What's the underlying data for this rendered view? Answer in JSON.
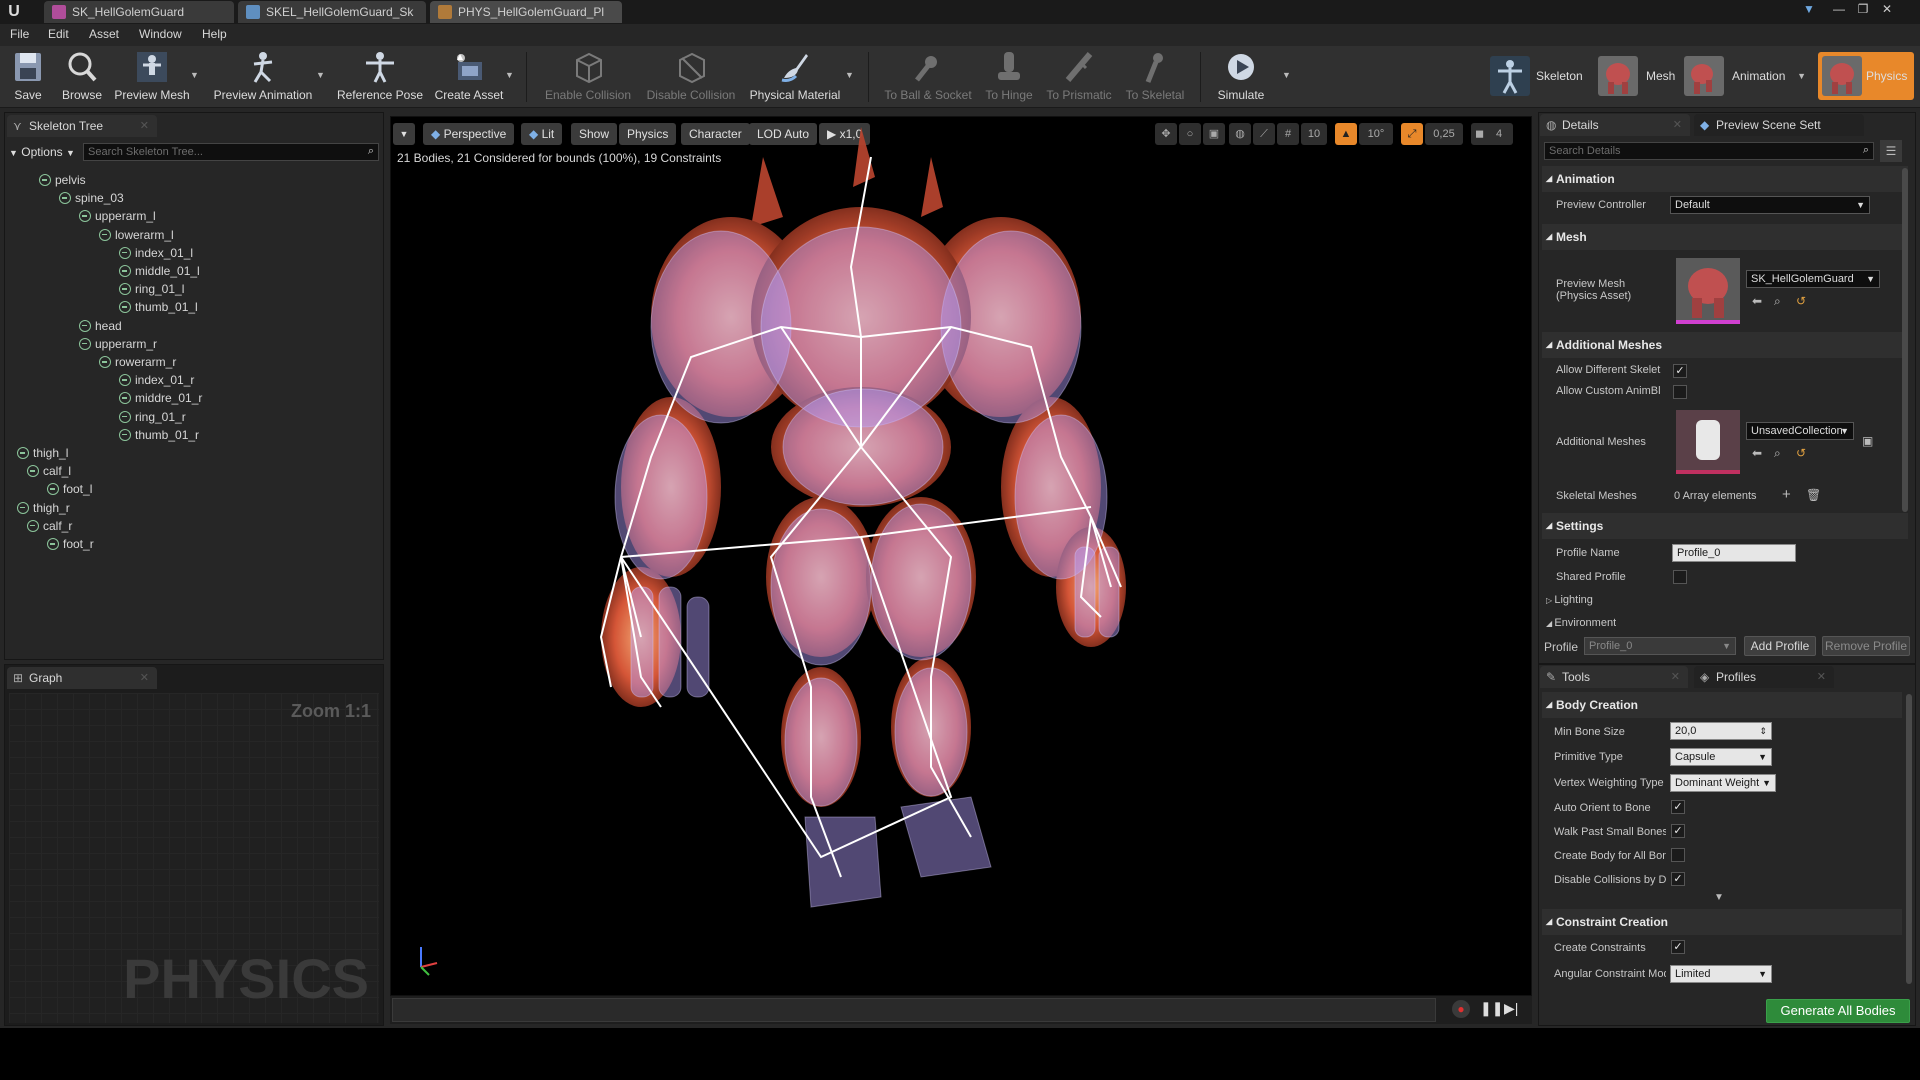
{
  "tabs": [
    {
      "label": "SK_HellGolemGuard",
      "color": "#b04d9a"
    },
    {
      "label": "SKEL_HellGolemGuard_Sk",
      "color": "#5f8fc0"
    },
    {
      "label": "PHYS_HellGolemGuard_Pl",
      "color": "#b07a3a"
    }
  ],
  "window": {
    "minimize": "—",
    "restore": "❐",
    "close": "✕"
  },
  "menu": [
    "File",
    "Edit",
    "Asset",
    "Window",
    "Help"
  ],
  "toolbar": {
    "save": "Save",
    "browse": "Browse",
    "preview_mesh": "Preview Mesh",
    "preview_animation": "Preview Animation",
    "reference_pose": "Reference Pose",
    "create_asset": "Create Asset",
    "enable_collision": "Enable Collision",
    "disable_collision": "Disable Collision",
    "physical_material": "Physical Material",
    "to_ball_socket": "To Ball & Socket",
    "to_hinge": "To Hinge",
    "to_prismatic": "To Prismatic",
    "to_skeletal": "To Skeletal",
    "simulate": "Simulate"
  },
  "modes": {
    "skeleton": "Skeleton",
    "mesh": "Mesh",
    "animation": "Animation",
    "physics": "Physics"
  },
  "skeleton_tree": {
    "tab": "Skeleton Tree",
    "options": "Options",
    "search_placeholder": "Search Skeleton Tree...",
    "bones": [
      "pelvis",
      "spine_03",
      "upperarm_l",
      "lowerarm_l",
      "index_01_l",
      "middle_01_l",
      "ring_01_l",
      "thumb_01_l",
      "head",
      "upperarm_r",
      "rowerarm_r",
      "index_01_r",
      "middre_01_r",
      "ring_01_r",
      "thumb_01_r",
      "thigh_l",
      "calf_l",
      "foot_l",
      "thigh_r",
      "calf_r",
      "foot_r"
    ]
  },
  "graph": {
    "tab": "Graph",
    "zoom": "Zoom 1:1",
    "watermark": "PHYSICS"
  },
  "viewport": {
    "perspective": "Perspective",
    "lit": "Lit",
    "show": "Show",
    "physics": "Physics",
    "character": "Character",
    "lod": "LOD Auto",
    "speed": "x1,0",
    "grid_size": "10",
    "angle": "10°",
    "scale": "0,25",
    "camera_speed": "4",
    "stats": "21 Bodies, 21 Considered for bounds (100%), 19 Constraints"
  },
  "details": {
    "tab": "Details",
    "tab2": "Preview Scene Sett",
    "search_placeholder": "Search Details",
    "animation_section": "Animation",
    "preview_controller_label": "Preview Controller",
    "preview_controller_value": "Default",
    "mesh_section": "Mesh",
    "preview_mesh_label": "Preview Mesh (Physics Asset)",
    "preview_mesh_value": "SK_HellGolemGuard",
    "additional_section": "Additional Meshes",
    "allow_diff_skel": "Allow Different Skelet",
    "allow_custom_anim": "Allow Custom AnimBl",
    "additional_meshes_label": "Additional Meshes",
    "additional_meshes_value": "UnsavedCollection",
    "skeletal_meshes_label": "Skeletal Meshes",
    "skeletal_meshes_value": "0 Array elements",
    "settings_section": "Settings",
    "profile_name_label": "Profile Name",
    "profile_name_value": "Profile_0",
    "shared_profile_label": "Shared Profile",
    "lighting": "Lighting",
    "environment": "Environment",
    "profile_label": "Profile",
    "profile_value": "Profile_0",
    "add_profile": "Add Profile",
    "remove_profile": "Remove Profile"
  },
  "tools": {
    "tab": "Tools",
    "tab2": "Profiles",
    "body_creation": "Body Creation",
    "min_bone_size_label": "Min Bone Size",
    "min_bone_size_value": "20,0",
    "primitive_type_label": "Primitive Type",
    "primitive_type_value": "Capsule",
    "vertex_weighting_label": "Vertex Weighting Type",
    "vertex_weighting_value": "Dominant Weight",
    "auto_orient_label": "Auto Orient to Bone",
    "walk_past_label": "Walk Past Small Bones",
    "create_body_label": "Create Body for All Bones",
    "disable_collisions_label": "Disable Collisions by Default",
    "constraint_creation": "Constraint Creation",
    "create_constraints_label": "Create Constraints",
    "angular_label": "Angular Constraint Mode",
    "angular_value": "Limited",
    "generate": "Generate All Bodies"
  },
  "colors": {
    "accent_physics": "#e8882a",
    "generate": "#2e8b3a",
    "bone_icon": "#8bc49a",
    "body": "#b4a0ff"
  }
}
